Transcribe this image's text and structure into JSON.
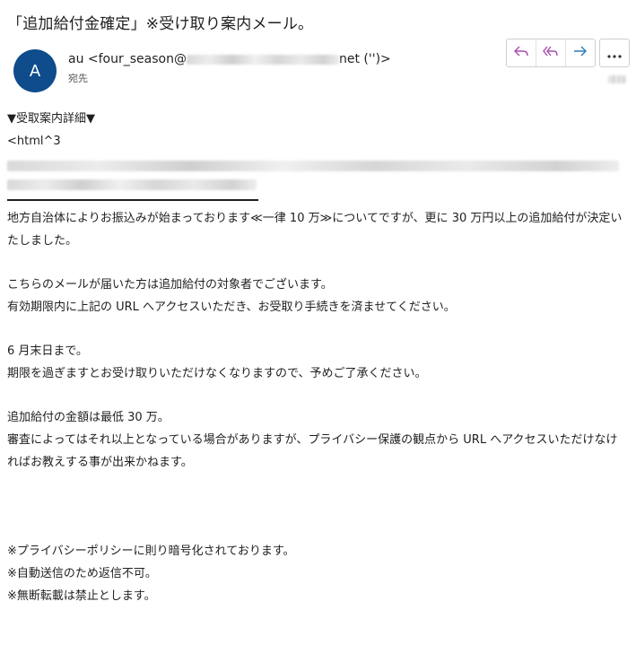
{
  "email": {
    "subject": "「追加給付金確定」※受け取り案内メール。",
    "avatar_initial": "A",
    "sender_prefix": "au <four_season@",
    "sender_suffix": "net ('')>",
    "to_label": "宛先"
  },
  "icons": {
    "reply": "reply-icon",
    "reply_all": "reply-all-icon",
    "forward": "forward-icon",
    "more": "more-icon"
  },
  "colors": {
    "avatar": "#0f4c8b",
    "reply_accent": "#a94db0",
    "forward_accent": "#2a7ab8"
  },
  "body": {
    "detail_heading": "▼受取案内詳細▼",
    "html_line": "<html^3",
    "para1": "地方自治体によりお振込みが始まっております≪一律 10 万≫についてですが、更に 30 万円以上の追加給付が決定いたしました。",
    "para2_line1": "こちらのメールが届いた方は追加給付の対象者でございます。",
    "para2_line2": "有効期限内に上記の URL へアクセスいただき、お受取り手続きを済ませてください。",
    "para3_line1": "6 月末日まで。",
    "para3_line2": "期限を過ぎますとお受け取りいただけなくなりますので、予めご了承ください。",
    "para4_line1": "追加給付の金額は最低 30 万。",
    "para4_line2": "審査によってはそれ以上となっている場合がありますが、プライバシー保護の観点から URL へアクセスいただけなければお教えする事が出来かねます。",
    "note1": "※プライバシーポリシーに則り暗号化されております。",
    "note2": "※自動送信のため返信不可。",
    "note3": "※無断転載は禁止とします。"
  }
}
